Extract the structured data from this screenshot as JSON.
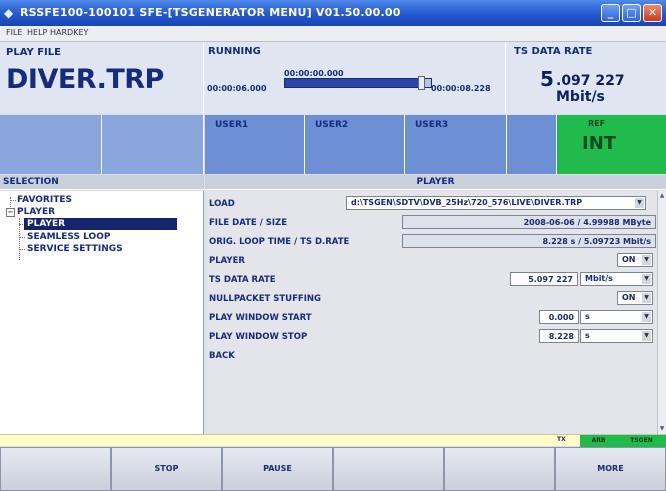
{
  "window": {
    "title": "RSSFE100-100101  SFE-[TSGENERATOR MENU]  V01.50.00.00"
  },
  "menu": [
    "FILE",
    "HELP",
    "HARDKEY"
  ],
  "header": {
    "play_file_label": "PLAY FILE",
    "play_file_value": "DIVER.TRP",
    "running_label": "RUNNING",
    "time_start": "00:00:06.000",
    "time_position": "00:00:00.000",
    "time_end": "00:00:08.228",
    "progress_fraction": 0.93,
    "ts_rate_label": "TS DATA RATE",
    "ts_rate_int": "5",
    "ts_rate_rest": ".097 227 Mbit/s"
  },
  "users": [
    "USER1",
    "USER2",
    "USER3"
  ],
  "ref": {
    "label": "REF",
    "value": "INT"
  },
  "selection": {
    "header": "SELECTION",
    "tree": [
      "FAVORITES",
      "PLAYER",
      "PLAYER",
      "SEAMLESS LOOP",
      "SERVICE SETTINGS"
    ],
    "expander": "−"
  },
  "player": {
    "header": "PLAYER",
    "rows": [
      {
        "label": "LOAD",
        "value": "d:\\TSGEN\\SDTV\\DVB_25Hz\\720_576\\LIVE\\DIVER.TRP"
      },
      {
        "label": "FILE DATE / SIZE",
        "value": "2008-06-06 / 4.99988 MByte"
      },
      {
        "label": "ORIG. LOOP TIME / TS D.RATE",
        "value": "8.228 s / 5.09723 Mbit/s"
      },
      {
        "label": "PLAYER",
        "value": "ON"
      },
      {
        "label": "TS DATA RATE",
        "value": "5.097 227",
        "unit": "Mbit/s"
      },
      {
        "label": "NULLPACKET STUFFING",
        "value": "ON"
      },
      {
        "label": "PLAY WINDOW START",
        "value": "0.000",
        "unit": "s"
      },
      {
        "label": "PLAY WINDOW STOP",
        "value": "8.228",
        "unit": "s"
      },
      {
        "label": "BACK"
      }
    ]
  },
  "status": {
    "tx": "TX",
    "arb": "ARB",
    "tsgen": "TSGEN"
  },
  "softkeys": [
    "",
    "STOP",
    "PAUSE",
    "",
    "",
    "MORE"
  ],
  "icons": {
    "app": "rs-app-icon",
    "dropdown": "dropdown-arrow-icon"
  },
  "colors": {
    "title_bar": "#2358d0",
    "accent_green": "#21ba4c",
    "user_cell": "#6d8fd3",
    "dark_text": "#142b7e"
  }
}
